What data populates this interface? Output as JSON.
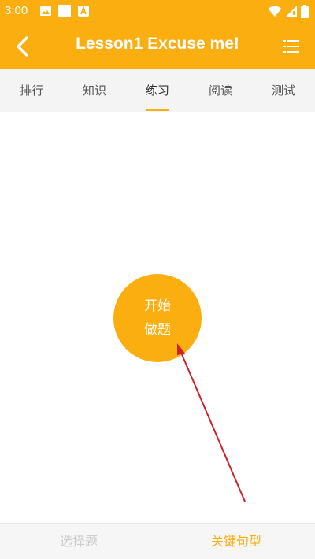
{
  "status_bar": {
    "time": "3:00",
    "icons": [
      "image-icon",
      "white-square-icon",
      "a-icon",
      "wifi-icon",
      "signal-icon",
      "battery-icon"
    ]
  },
  "app_bar": {
    "title": "Lesson1 Excuse me!",
    "back_icon": "chevron-left-icon",
    "menu_icon": "list-icon"
  },
  "tabs": [
    {
      "label": "排行",
      "active": false
    },
    {
      "label": "知识",
      "active": false
    },
    {
      "label": "练习",
      "active": true
    },
    {
      "label": "阅读",
      "active": false
    },
    {
      "label": "测试",
      "active": false
    }
  ],
  "main": {
    "start_button": {
      "line1": "开始",
      "line2": "做题"
    },
    "annotation": "red-arrow-icon"
  },
  "bottom_nav": [
    {
      "label": "选择题",
      "active": false
    },
    {
      "label": "关键句型",
      "active": true
    }
  ],
  "colors": {
    "accent": "#FBAE0F",
    "tab_bar_bg": "#F4F4F4",
    "arrow": "#D0202A",
    "inactive_text": "#CCCCCC"
  }
}
